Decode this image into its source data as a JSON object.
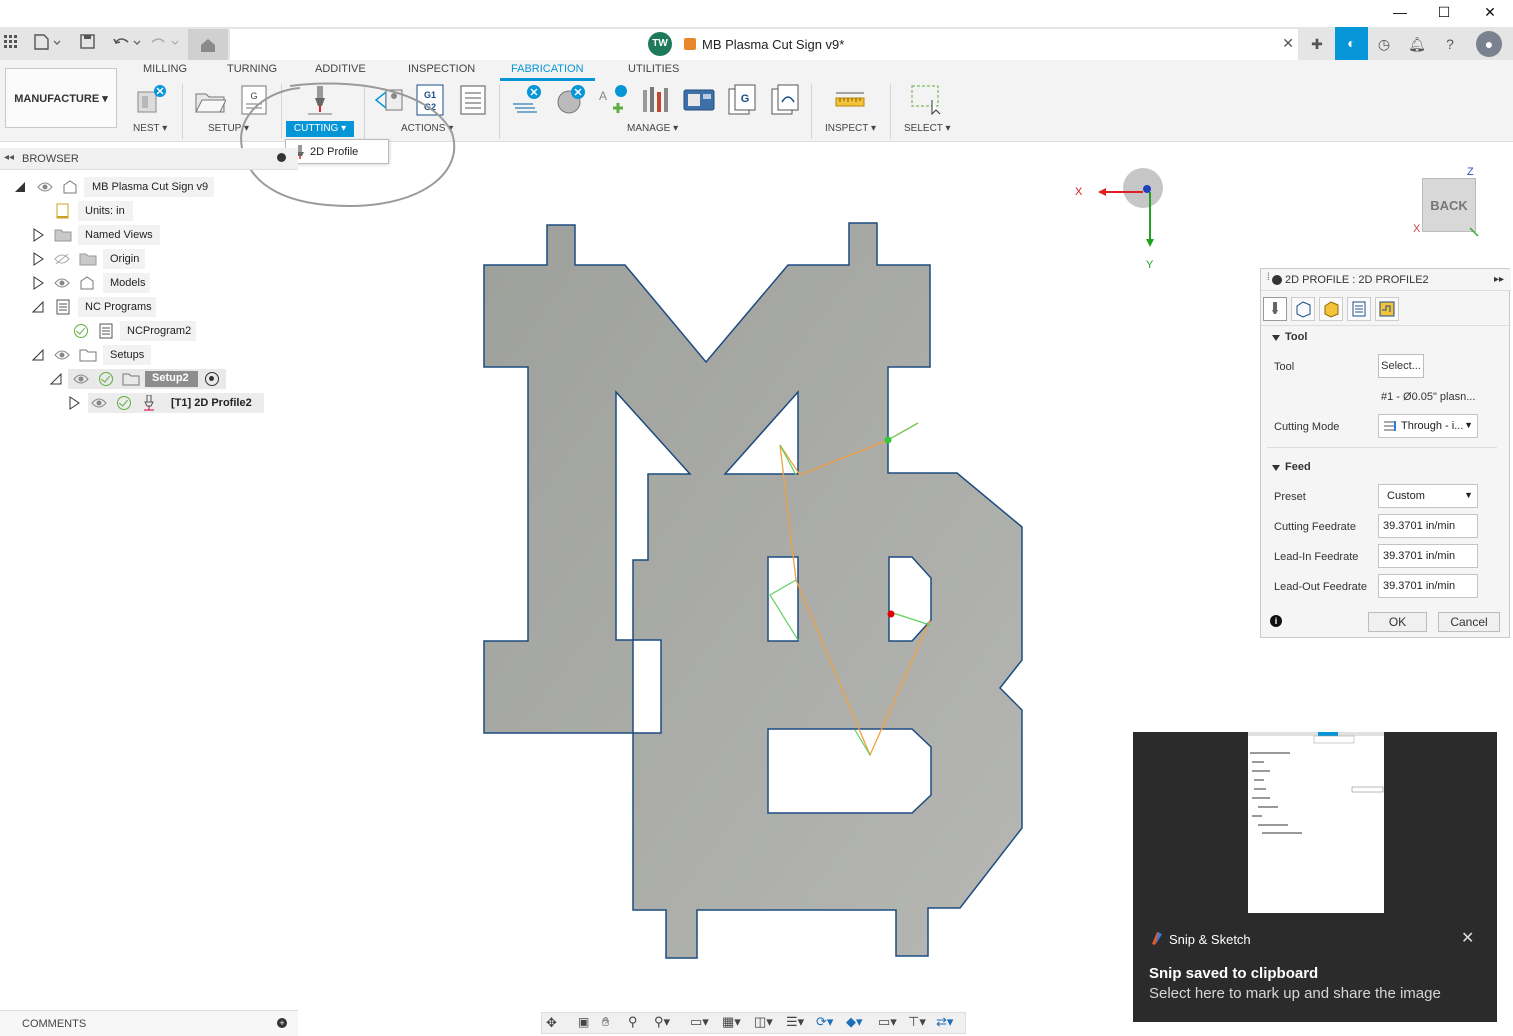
{
  "window": {
    "minimize": "—",
    "maximize": "☐",
    "close": "✕"
  },
  "tab": {
    "avatar_initials": "TW",
    "document_title": "MB Plasma Cut Sign v9*",
    "close": "✕"
  },
  "ribbon": {
    "workspace": "MANUFACTURE",
    "workspace_caret": "▾",
    "tabs": [
      "MILLING",
      "TURNING",
      "ADDITIVE",
      "INSPECTION",
      "FABRICATION",
      "UTILITIES"
    ],
    "active_tab": "FABRICATION",
    "groups": {
      "nest": "NEST ▾",
      "setup": "SETUP ▾",
      "cutting": "CUTTING ▾",
      "actions": "ACTIONS ▾",
      "manage": "MANAGE ▾",
      "inspect": "INSPECT ▾",
      "select": "SELECT ▾"
    },
    "accent_color": "#0696d7"
  },
  "cutting_dropdown": {
    "items": [
      "2D Profile"
    ]
  },
  "browser": {
    "title": "BROWSER",
    "nodes": {
      "root": "MB Plasma Cut Sign v9",
      "units": "Units: in",
      "named_views": "Named Views",
      "origin": "Origin",
      "models": "Models",
      "nc_programs": "NC Programs",
      "nc_program2": "NCProgram2",
      "setups": "Setups",
      "setup2": "Setup2",
      "profile": "[T1] 2D Profile2"
    }
  },
  "viewport": {
    "axis_x": "X",
    "axis_y": "Y",
    "cube_face": "BACK",
    "cube_z": "Z",
    "cube_x": "X"
  },
  "dialog": {
    "title": "2D PROFILE : 2D PROFILE2",
    "sections": {
      "tool": "Tool",
      "feed": "Feed"
    },
    "tool_label": "Tool",
    "tool_button": "Select...",
    "tool_desc": "#1 - Ø0.05\" plasn...",
    "cutting_mode_label": "Cutting Mode",
    "cutting_mode_value": "Through - i...",
    "preset_label": "Preset",
    "preset_value": "Custom",
    "cutting_feedrate_label": "Cutting Feedrate",
    "cutting_feedrate_value": "39.3701 in/min",
    "leadin_feedrate_label": "Lead-In Feedrate",
    "leadin_feedrate_value": "39.3701 in/min",
    "leadout_feedrate_label": "Lead-Out Feedrate",
    "leadout_feedrate_value": "39.3701 in/min",
    "ok": "OK",
    "cancel": "Cancel"
  },
  "comments": {
    "label": "COMMENTS"
  },
  "toast": {
    "app": "Snip & Sketch",
    "title": "Snip saved to clipboard",
    "subtitle": "Select here to mark up and share the image",
    "close": "✕"
  }
}
